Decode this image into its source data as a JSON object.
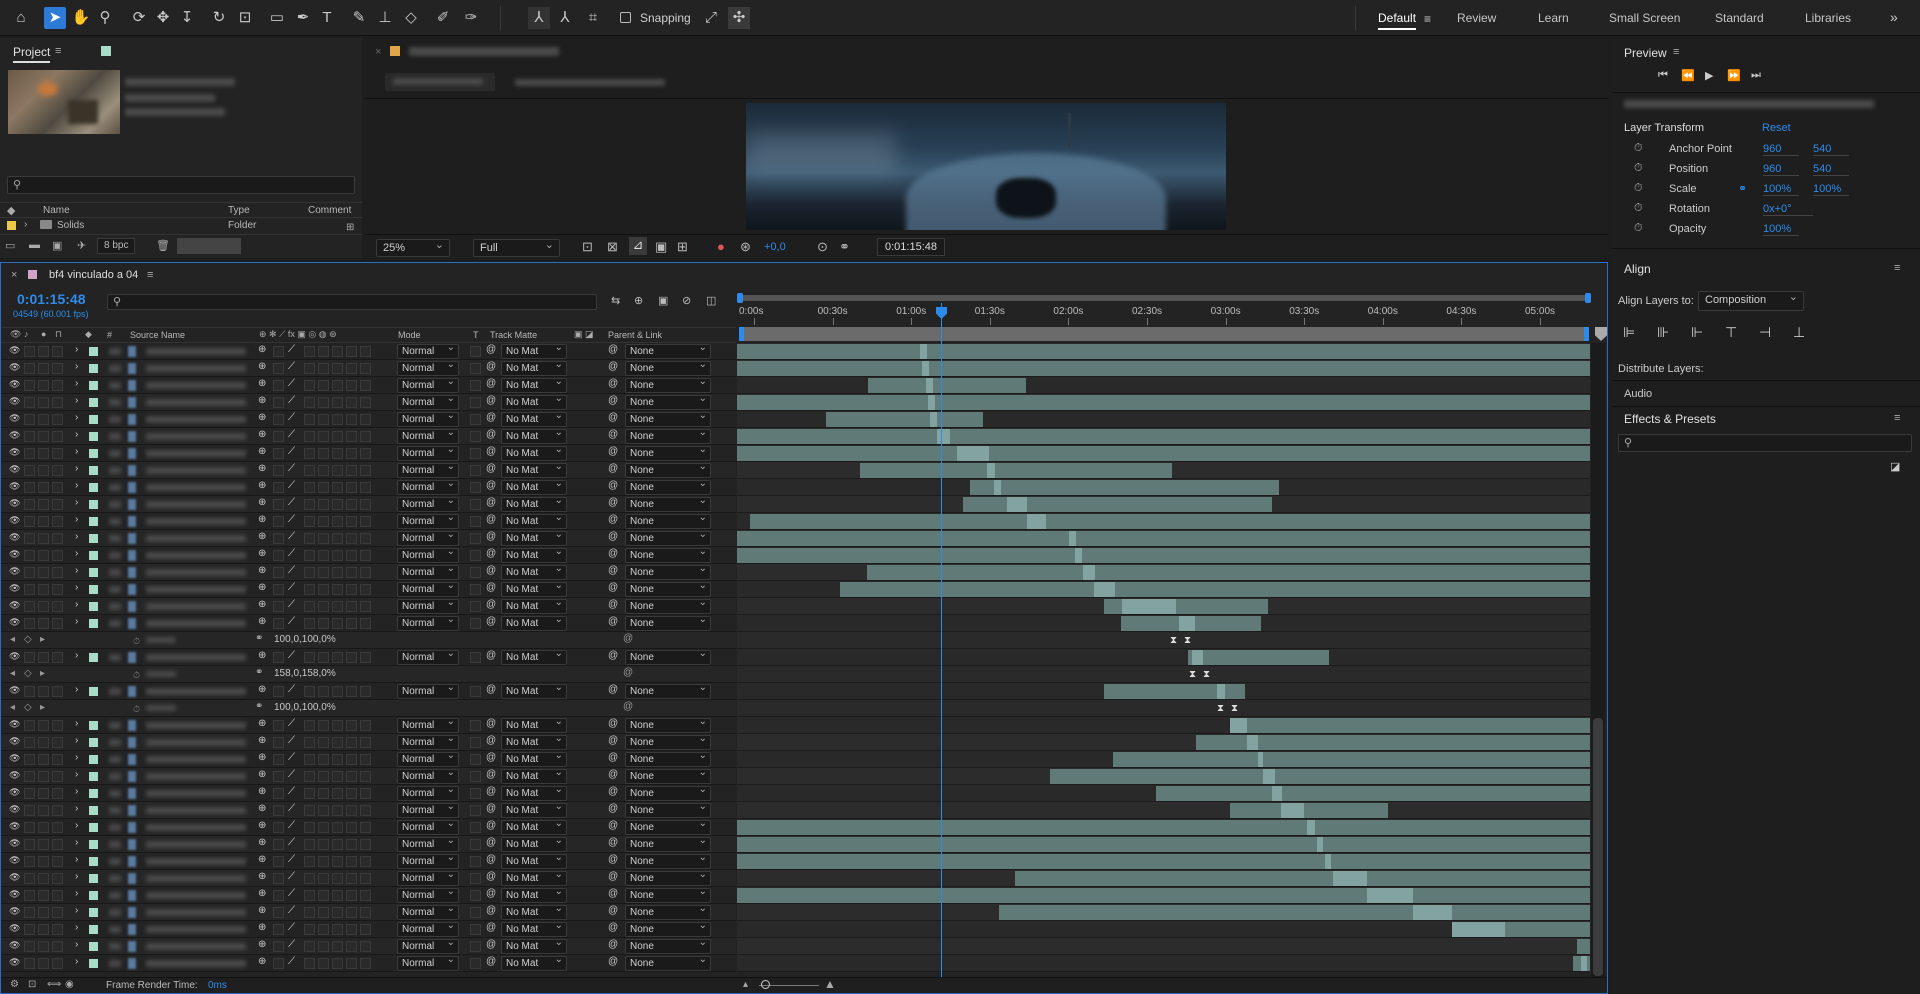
{
  "toolbar": {
    "snapping_label": "Snapping",
    "workspaces": [
      "Default",
      "Review",
      "Learn",
      "Small Screen",
      "Standard",
      "Libraries"
    ],
    "active_workspace": "Default",
    "more_icon": "chevron-double-right-icon"
  },
  "project": {
    "title": "Project",
    "columns": [
      "Name",
      "Type",
      "Comment"
    ],
    "items": [
      {
        "name": "Solids",
        "type": "Folder"
      }
    ],
    "bpc": "8 bpc"
  },
  "viewer": {
    "zoom": "25%",
    "resolution": "Full",
    "exposure": "+0,0",
    "timecode": "0:01:15:48"
  },
  "timeline": {
    "comp_tab": "bf4 vinculado a 04",
    "current_time": "0:01:15:48",
    "frame_info": "04549 (60.001 fps)",
    "headers": {
      "source_name": "Source Name",
      "mode": "Mode",
      "t": "T",
      "track_matte": "Track Matte",
      "parent": "Parent & Link",
      "hash": "#"
    },
    "mode_value": "Normal",
    "matte_value": "No Mat",
    "parent_value": "None",
    "ruler": [
      "0:00s",
      "00:30s",
      "01:00s",
      "01:30s",
      "02:00s",
      "02:30s",
      "03:00s",
      "03:30s",
      "04:00s",
      "04:30s",
      "05:00s"
    ],
    "scale_values": [
      "100,0,100,0%",
      "158,0,158,0%",
      "100,0,100,0%"
    ],
    "frame_render_label": "Frame Render Time:",
    "frame_render_value": "0ms"
  },
  "preview": {
    "title": "Preview"
  },
  "properties": {
    "section": "Layer Transform",
    "reset": "Reset",
    "anchor_label": "Anchor Point",
    "anchor_x": "960",
    "anchor_y": "540",
    "position_label": "Position",
    "position_x": "960",
    "position_y": "540",
    "scale_label": "Scale",
    "scale_x": "100%",
    "scale_y": "100%",
    "rotation_label": "Rotation",
    "rotation_value": "0x+0°",
    "opacity_label": "Opacity",
    "opacity_value": "100%"
  },
  "align": {
    "title": "Align",
    "align_to_label": "Align Layers to:",
    "align_to_value": "Composition",
    "distribute_label": "Distribute Layers:"
  },
  "audio": {
    "title": "Audio"
  },
  "effects": {
    "title": "Effects & Presets"
  },
  "colors": {
    "accent": "#2d8ceb",
    "bar": "#5f7a77",
    "bar_highlight": "#82a39f",
    "label_green": "#a8dcc9"
  }
}
